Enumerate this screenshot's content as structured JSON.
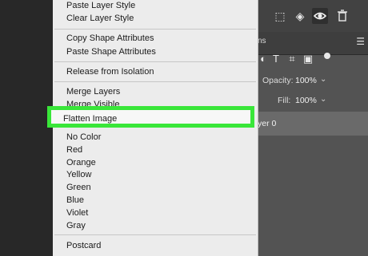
{
  "menu": {
    "group1": [
      "Paste Layer Style",
      "Clear Layer Style"
    ],
    "group2": [
      "Copy Shape Attributes",
      "Paste Shape Attributes"
    ],
    "group3": [
      "Release from Isolation"
    ],
    "group4": [
      "Merge Layers",
      "Merge Visible"
    ],
    "highlighted": "Flatten Image",
    "colors": [
      "No Color",
      "Red",
      "Orange",
      "Yellow",
      "Green",
      "Blue",
      "Violet",
      "Gray"
    ],
    "group6": [
      "Postcard"
    ]
  },
  "panel": {
    "tab_label": "ns",
    "opacity_label": "Opacity:",
    "opacity_value": "100%",
    "fill_label": "Fill:",
    "fill_value": "100%",
    "layer_name": "yer 0",
    "toolbar_icons": [
      "grid-select-icon",
      "transform-icon",
      "visibility-eye-icon",
      "trash-icon"
    ],
    "filter_icons": [
      "text-filter-icon",
      "shape-filter-icon",
      "smart-object-filter-icon",
      "pixel-dot-icon"
    ]
  },
  "colors": {
    "highlight_border": "#39e639",
    "menu_bg": "#ececec",
    "panel_bg": "#535353"
  }
}
